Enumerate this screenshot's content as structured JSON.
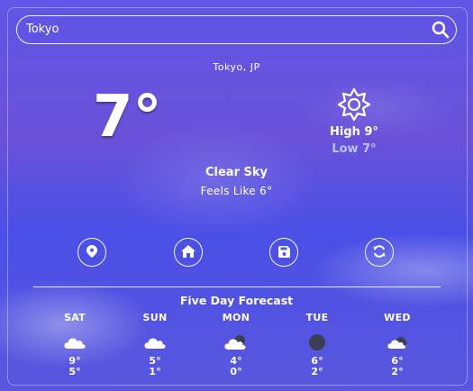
{
  "search": {
    "value": "Tokyo"
  },
  "current": {
    "location": "Tokyo, JP",
    "temp": "7°",
    "high": "High 9°",
    "low": "Low 7°",
    "description": "Clear Sky",
    "feels_like": "Feels Like 6°",
    "icon": "sun-icon"
  },
  "actions": [
    {
      "icon": "location-pin-icon"
    },
    {
      "icon": "home-icon"
    },
    {
      "icon": "save-icon"
    },
    {
      "icon": "refresh-icon"
    }
  ],
  "forecast": {
    "title": "Five Day Forecast",
    "days": [
      {
        "day": "SAT",
        "icon": "cloud-icon",
        "high": "9°",
        "low": "5°"
      },
      {
        "day": "SUN",
        "icon": "cloud-icon",
        "high": "5°",
        "low": "1°"
      },
      {
        "day": "MON",
        "icon": "partly-cloudy-icon",
        "high": "4°",
        "low": "0°"
      },
      {
        "day": "TUE",
        "icon": "overcast-icon",
        "high": "6°",
        "low": "2°"
      },
      {
        "day": "WED",
        "icon": "cloudy-icon",
        "high": "6°",
        "low": "2°"
      }
    ]
  },
  "colors": {
    "low_text": "#b8c3ff",
    "accent_white": "#ffffff"
  }
}
